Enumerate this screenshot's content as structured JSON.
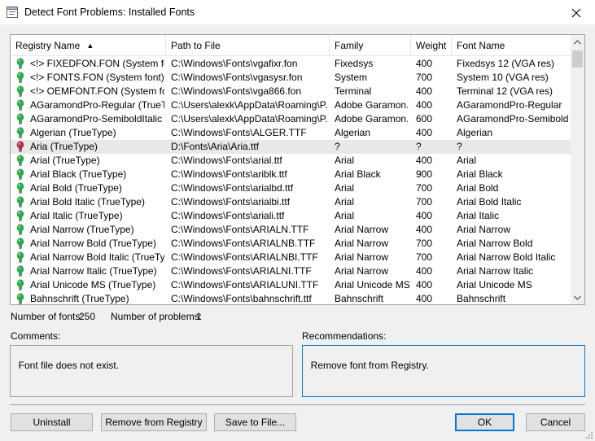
{
  "window": {
    "title": "Detect Font Problems: Installed Fonts",
    "close_glyph": "✕"
  },
  "columns": [
    "Registry Name",
    "Path to File",
    "Family",
    "Weight",
    "Font Name"
  ],
  "sort_indicator": "▲",
  "rows": [
    {
      "status": "ok",
      "name": "<!> FIXEDFON.FON (System font)",
      "path": "C:\\Windows\\Fonts\\vgafixr.fon",
      "family": "Fixedsys",
      "weight": "400",
      "font": "Fixedsys 12 (VGA res)"
    },
    {
      "status": "ok",
      "name": "<!> FONTS.FON (System font)",
      "path": "C:\\Windows\\Fonts\\vgasysr.fon",
      "family": "System",
      "weight": "700",
      "font": "System 10 (VGA res)"
    },
    {
      "status": "ok",
      "name": "<!> OEMFONT.FON (System font)",
      "path": "C:\\Windows\\Fonts\\vga866.fon",
      "family": "Terminal",
      "weight": "400",
      "font": "Terminal 12 (VGA res)"
    },
    {
      "status": "ok",
      "name": "AGaramondPro-Regular (TrueTy...",
      "path": "C:\\Users\\alexk\\AppData\\Roaming\\P...",
      "family": "Adobe Garamon...",
      "weight": "400",
      "font": "AGaramondPro-Regular"
    },
    {
      "status": "ok",
      "name": "AGaramondPro-SemiboldItalic (Tr...",
      "path": "C:\\Users\\alexk\\AppData\\Roaming\\P...",
      "family": "Adobe Garamon...",
      "weight": "600",
      "font": "AGaramondPro-Semibold..."
    },
    {
      "status": "ok",
      "name": "Algerian (TrueType)",
      "path": "C:\\Windows\\Fonts\\ALGER.TTF",
      "family": "Algerian",
      "weight": "400",
      "font": "Algerian"
    },
    {
      "status": "problem",
      "name": "Aria (TrueType)",
      "path": "D:\\Fonts\\Aria\\Aria.ttf",
      "family": "?",
      "weight": "?",
      "font": "?"
    },
    {
      "status": "ok",
      "name": "Arial (TrueType)",
      "path": "C:\\Windows\\Fonts\\arial.ttf",
      "family": "Arial",
      "weight": "400",
      "font": "Arial"
    },
    {
      "status": "ok",
      "name": "Arial Black (TrueType)",
      "path": "C:\\Windows\\Fonts\\ariblk.ttf",
      "family": "Arial Black",
      "weight": "900",
      "font": "Arial Black"
    },
    {
      "status": "ok",
      "name": "Arial Bold (TrueType)",
      "path": "C:\\Windows\\Fonts\\arialbd.ttf",
      "family": "Arial",
      "weight": "700",
      "font": "Arial Bold"
    },
    {
      "status": "ok",
      "name": "Arial Bold Italic (TrueType)",
      "path": "C:\\Windows\\Fonts\\arialbi.ttf",
      "family": "Arial",
      "weight": "700",
      "font": "Arial Bold Italic"
    },
    {
      "status": "ok",
      "name": "Arial Italic (TrueType)",
      "path": "C:\\Windows\\Fonts\\ariali.ttf",
      "family": "Arial",
      "weight": "400",
      "font": "Arial Italic"
    },
    {
      "status": "ok",
      "name": "Arial Narrow (TrueType)",
      "path": "C:\\Windows\\Fonts\\ARIALN.TTF",
      "family": "Arial Narrow",
      "weight": "400",
      "font": "Arial Narrow"
    },
    {
      "status": "ok",
      "name": "Arial Narrow Bold (TrueType)",
      "path": "C:\\Windows\\Fonts\\ARIALNB.TTF",
      "family": "Arial Narrow",
      "weight": "700",
      "font": "Arial Narrow Bold"
    },
    {
      "status": "ok",
      "name": "Arial Narrow Bold Italic (TrueType)",
      "path": "C:\\Windows\\Fonts\\ARIALNBI.TTF",
      "family": "Arial Narrow",
      "weight": "700",
      "font": "Arial Narrow Bold Italic"
    },
    {
      "status": "ok",
      "name": "Arial Narrow Italic (TrueType)",
      "path": "C:\\Windows\\Fonts\\ARIALNI.TTF",
      "family": "Arial Narrow",
      "weight": "400",
      "font": "Arial Narrow Italic"
    },
    {
      "status": "ok",
      "name": "Arial Unicode MS (TrueType)",
      "path": "C:\\Windows\\Fonts\\ARIALUNI.TTF",
      "family": "Arial Unicode MS",
      "weight": "400",
      "font": "Arial Unicode MS"
    },
    {
      "status": "ok",
      "name": "Bahnschrift (TrueType)",
      "path": "C:\\Windows\\Fonts\\bahnschrift.ttf",
      "family": "Bahnschrift",
      "weight": "400",
      "font": "Bahnschrift"
    }
  ],
  "selected_row": 6,
  "status_colors": {
    "ok": "#2fa84f",
    "problem": "#b3304a"
  },
  "stats": {
    "fonts_label": "Number of fonts:",
    "fonts_count": "250",
    "problems_label": "Number of problems:",
    "problems_count": "1"
  },
  "comments": {
    "label": "Comments:",
    "text": "Font file does not exist."
  },
  "recommendations": {
    "label": "Recommendations:",
    "text": "Remove font from Registry."
  },
  "buttons": {
    "uninstall": "Uninstall",
    "remove": "Remove from Registry",
    "save": "Save to File...",
    "ok": "OK",
    "cancel": "Cancel"
  }
}
